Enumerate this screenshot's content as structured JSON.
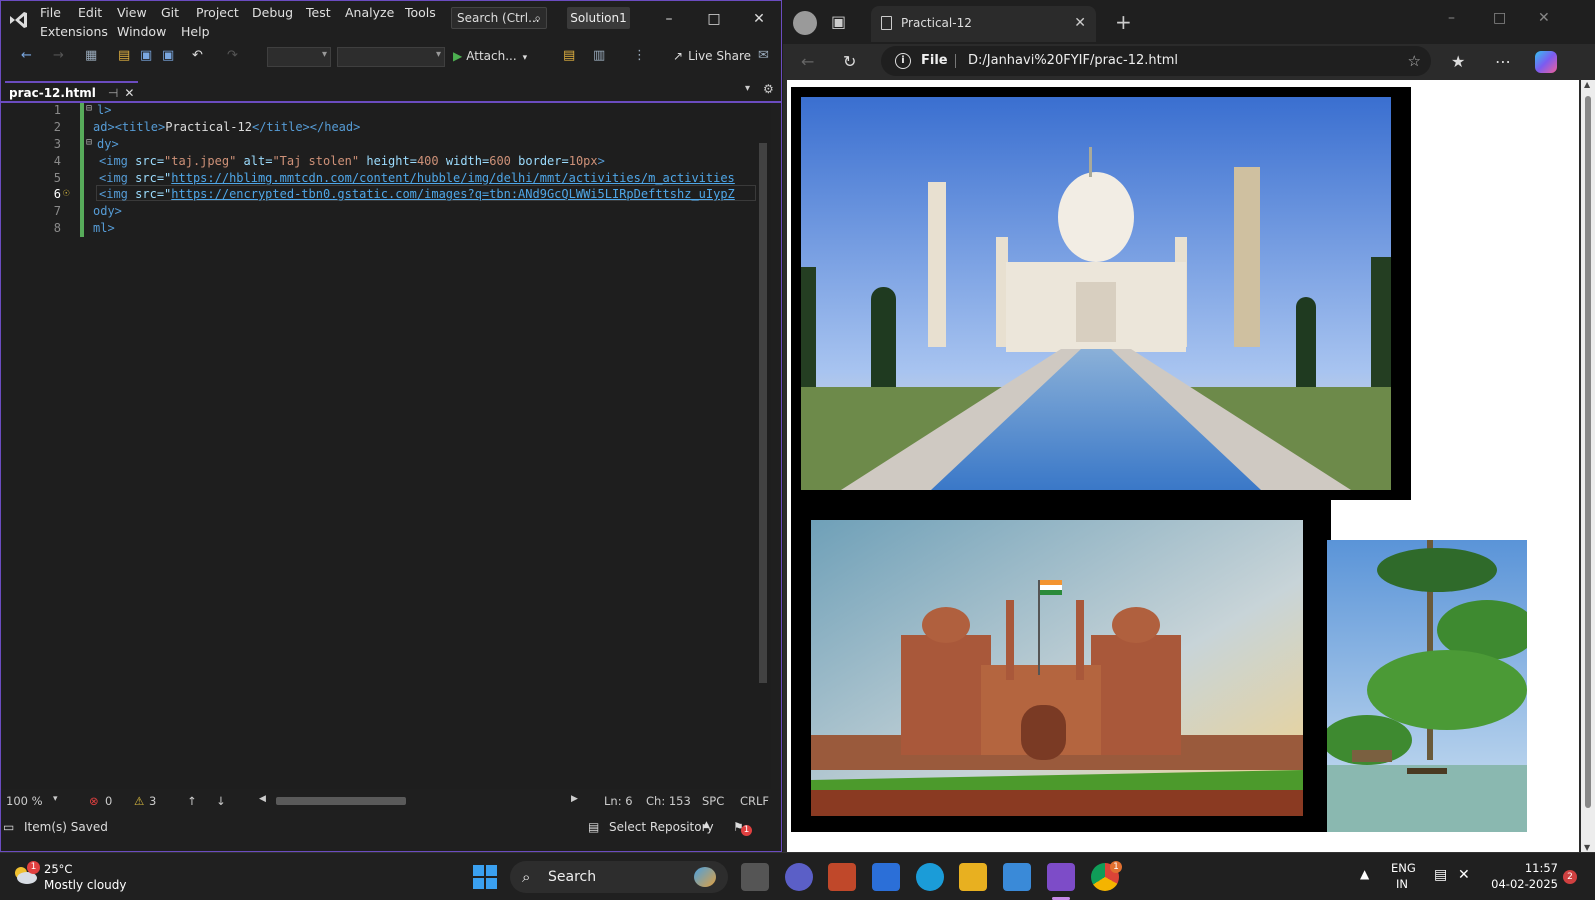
{
  "vs": {
    "menu": [
      "File",
      "Edit",
      "View",
      "Git",
      "Project",
      "Debug",
      "Test",
      "Analyze",
      "Tools",
      "Extensions",
      "Window",
      "Help"
    ],
    "search_placeholder": "Search (Ctrl...",
    "solution": "Solution1",
    "attach_label": "Attach...",
    "liveshare_label": "Live Share",
    "doc_tab": "prac-12.html",
    "code_lines": [
      {
        "n": "1"
      },
      {
        "n": "2"
      },
      {
        "n": "3"
      },
      {
        "n": "4"
      },
      {
        "n": "5"
      },
      {
        "n": "6"
      },
      {
        "n": "7"
      },
      {
        "n": "8"
      }
    ],
    "code": {
      "l1": "l>",
      "l2_a": "ad>",
      "l2_title_open": "<title>",
      "l2_text": "Practical-12",
      "l2_title_close": "</title></head>",
      "l3": "dy>",
      "l4_tag": "<img",
      "l4_src_attr": "src=",
      "l4_src": "\"taj.jpeg\"",
      "l4_alt_attr": "alt=",
      "l4_alt": "\"Taj stolen\"",
      "l4_rest_attr1": "height=",
      "l4_rest_val1": "400",
      "l4_rest_attr2": "width=",
      "l4_rest_val2": "600",
      "l4_rest_attr3": "border=",
      "l4_rest_val3": "10px",
      "l4_close": ">",
      "l5_tag": "<img",
      "l5_src_attr": "src=\"",
      "l5_url": "https://hblimg.mmtcdn.com/content/hubble/img/delhi/mmt/activities/m_activities",
      "l6_tag": "<img",
      "l6_src_attr": "src=\"",
      "l6_url": "https://encrypted-tbn0.gstatic.com/images?q=tbn:ANd9GcQLWWi5LIRpDefttshz_uIypZ",
      "l7": "ody>",
      "l8": "ml>"
    },
    "status": {
      "zoom": "100 %",
      "errors": "0",
      "warnings": "3",
      "ln": "Ln: 6",
      "ch": "Ch: 153",
      "spc": "SPC",
      "crlf": "CRLF"
    },
    "bottom": {
      "saved": "Item(s) Saved",
      "repo": "Select Repository",
      "notif_count": "1"
    }
  },
  "edge": {
    "tab_title": "Practical-12",
    "file_label": "File",
    "url": "D:/Janhavi%20FYIF/prac-12.html",
    "images": [
      {
        "name": "taj-mahal",
        "alt": "Taj stolen"
      },
      {
        "name": "red-fort"
      },
      {
        "name": "kerala-backwaters"
      }
    ]
  },
  "taskbar": {
    "weather_temp": "25°C",
    "weather_desc": "Mostly cloudy",
    "weather_badge": "1",
    "search_label": "Search",
    "lang1": "ENG",
    "lang2": "IN",
    "time": "11:57",
    "date": "04-02-2025",
    "notif_badge": "2",
    "chrome_badge": "1"
  },
  "colors": {
    "vs_accent": "#6b4cc0",
    "tag": "#569cd6",
    "attr": "#9cdcfe",
    "string": "#ce9178",
    "link": "#4fa7e8"
  }
}
